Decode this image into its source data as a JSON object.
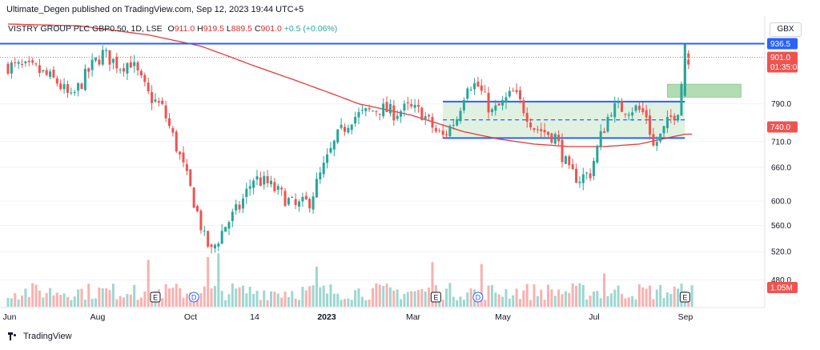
{
  "header": {
    "published": "Ultimate_Degen published on TradingView.com, Sep 12, 2023 19:44 UTC+5"
  },
  "legend": {
    "symbol": "VISTRY GROUP PLC GBP0.50, 1D, LSE",
    "o_label": "O",
    "o": "911.0",
    "h_label": "H",
    "h": "919.5",
    "l_label": "L",
    "l": "889.5",
    "c_label": "C",
    "c": "901.0",
    "change": "+0.5 (+0.06%)"
  },
  "currency": "GBX",
  "footer": {
    "brand": "TradingView"
  },
  "colors": {
    "up": "#26a69a",
    "down": "#ef5350",
    "ma": "#e53935",
    "hline": "#2962ff",
    "zone": "#c8e6c9",
    "box": "#a5d6a7",
    "grid": "#f0f3fa",
    "axis_text": "#131722"
  },
  "chart_data": {
    "type": "candlestick",
    "y_scale": "log",
    "ylim": [
      445,
      990
    ],
    "y_ticks": [
      {
        "label": "790.0",
        "value": 790
      },
      {
        "label": "710.0",
        "value": 710
      },
      {
        "label": "660.0",
        "value": 660
      },
      {
        "label": "600.0",
        "value": 600
      },
      {
        "label": "560.0",
        "value": 560
      },
      {
        "label": "520.0",
        "value": 520
      },
      {
        "label": "480.0",
        "value": 480
      }
    ],
    "x_ticks": [
      "Jun",
      "Aug",
      "Oct",
      "14",
      "2023",
      "Mar",
      "May",
      "Jul",
      "Sep"
    ],
    "price_labels": [
      {
        "label": "936.5",
        "value": 936.5,
        "color": "#2962ff"
      },
      {
        "label": "901.0",
        "value": 901,
        "color": "#ef5350"
      },
      {
        "label": "01:35:03",
        "value": 877,
        "color": "#ef5350"
      },
      {
        "label": "740.0",
        "value": 740,
        "color": "#ef5350"
      }
    ],
    "volume_label": "1.05M",
    "horizontal_lines": [
      {
        "value": 936.5,
        "style": "solid"
      }
    ],
    "range": {
      "top": 795,
      "bottom": 717,
      "mid": 755,
      "start_index": 124,
      "end_index": 193
    },
    "target_box": {
      "top": 835,
      "bottom": 805,
      "start_index": 188,
      "end_index": 209
    },
    "events": [
      {
        "label": "E",
        "index": 42
      },
      {
        "label": "D",
        "index": 53
      },
      {
        "label": "E",
        "index": 122
      },
      {
        "label": "D",
        "index": 134
      },
      {
        "label": "E",
        "index": 193
      }
    ],
    "moving_average_anchors": [
      [
        0,
        990
      ],
      [
        20,
        985
      ],
      [
        40,
        960
      ],
      [
        55,
        930
      ],
      [
        70,
        880
      ],
      [
        85,
        835
      ],
      [
        100,
        790
      ],
      [
        115,
        765
      ],
      [
        130,
        730
      ],
      [
        140,
        715
      ],
      [
        150,
        705
      ],
      [
        160,
        700
      ],
      [
        170,
        700
      ],
      [
        180,
        705
      ],
      [
        193,
        725
      ]
    ],
    "price_anchors": [
      [
        0,
        880
      ],
      [
        8,
        870
      ],
      [
        14,
        840
      ],
      [
        18,
        800
      ],
      [
        24,
        880
      ],
      [
        27,
        910
      ],
      [
        32,
        880
      ],
      [
        35,
        890
      ],
      [
        40,
        810
      ],
      [
        44,
        780
      ],
      [
        48,
        700
      ],
      [
        51,
        640
      ],
      [
        54,
        580
      ],
      [
        56,
        540
      ],
      [
        58,
        520
      ],
      [
        62,
        560
      ],
      [
        66,
        590
      ],
      [
        70,
        640
      ],
      [
        74,
        630
      ],
      [
        78,
        610
      ],
      [
        82,
        590
      ],
      [
        86,
        600
      ],
      [
        90,
        660
      ],
      [
        94,
        720
      ],
      [
        98,
        760
      ],
      [
        102,
        770
      ],
      [
        106,
        780
      ],
      [
        110,
        770
      ],
      [
        114,
        780
      ],
      [
        118,
        770
      ],
      [
        122,
        730
      ],
      [
        124,
        720
      ],
      [
        128,
        760
      ],
      [
        131,
        840
      ],
      [
        134,
        830
      ],
      [
        138,
        770
      ],
      [
        141,
        790
      ],
      [
        144,
        815
      ],
      [
        147,
        780
      ],
      [
        150,
        740
      ],
      [
        153,
        730
      ],
      [
        156,
        720
      ],
      [
        160,
        650
      ],
      [
        163,
        640
      ],
      [
        166,
        650
      ],
      [
        169,
        720
      ],
      [
        172,
        780
      ],
      [
        175,
        780
      ],
      [
        179,
        780
      ],
      [
        182,
        765
      ],
      [
        184,
        700
      ],
      [
        186,
        720
      ],
      [
        189,
        760
      ],
      [
        191,
        780
      ],
      [
        193,
        900
      ],
      [
        194,
        901
      ]
    ],
    "volume_spikes": [
      {
        "index": 36,
        "mult": 2.2
      },
      {
        "index": 40,
        "mult": 2.0
      },
      {
        "index": 57,
        "mult": 2.8
      },
      {
        "index": 60,
        "mult": 2.5
      },
      {
        "index": 88,
        "mult": 2.2
      },
      {
        "index": 121,
        "mult": 3.6
      },
      {
        "index": 135,
        "mult": 2.0
      },
      {
        "index": 170,
        "mult": 2.0
      },
      {
        "index": 193,
        "mult": 2.2
      }
    ]
  }
}
